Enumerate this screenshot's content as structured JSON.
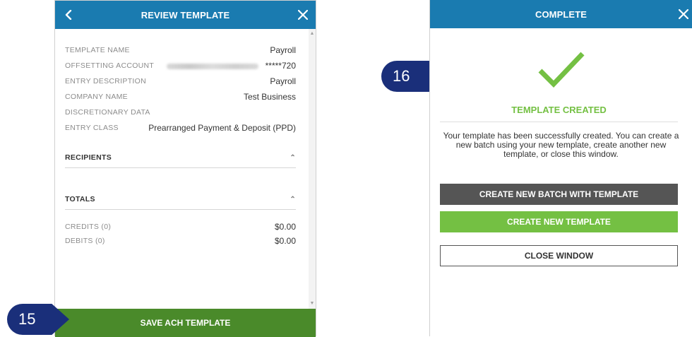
{
  "left_panel": {
    "title": "REVIEW TEMPLATE",
    "fields": [
      {
        "label": "TEMPLATE NAME",
        "value": "Payroll"
      },
      {
        "label": "OFFSETTING ACCOUNT",
        "value": "*****720"
      },
      {
        "label": "ENTRY DESCRIPTION",
        "value": "Payroll"
      },
      {
        "label": "COMPANY NAME",
        "value": "Test Business"
      },
      {
        "label": "DISCRETIONARY DATA",
        "value": ""
      },
      {
        "label": "ENTRY CLASS",
        "value": "Prearranged Payment & Deposit (PPD)"
      }
    ],
    "recipients_label": "RECIPIENTS",
    "totals_label": "TOTALS",
    "totals": [
      {
        "label": "CREDITS (0)",
        "value": "$0.00"
      },
      {
        "label": "DEBITS (0)",
        "value": "$0.00"
      }
    ],
    "save_label": "SAVE ACH TEMPLATE"
  },
  "badges": {
    "step_15": "15",
    "step_16": "16"
  },
  "right_panel": {
    "title": "COMPLETE",
    "status": "TEMPLATE CREATED",
    "message": "Your template has been successfully created. You can create a new batch using your new template, create another new template, or close this window.",
    "create_batch_label": "CREATE NEW BATCH WITH TEMPLATE",
    "create_template_label": "CREATE NEW TEMPLATE",
    "close_label": "CLOSE WINDOW"
  },
  "colors": {
    "header_blue": "#1a7bb0",
    "save_green": "#4a8a2a",
    "accent_green": "#74c043",
    "badge_navy": "#1a2f7a",
    "dark_button": "#555555"
  },
  "icons": {
    "back": "chevron-left-icon",
    "close": "close-icon",
    "success": "checkmark-icon",
    "caret": "chevron-up-icon"
  }
}
